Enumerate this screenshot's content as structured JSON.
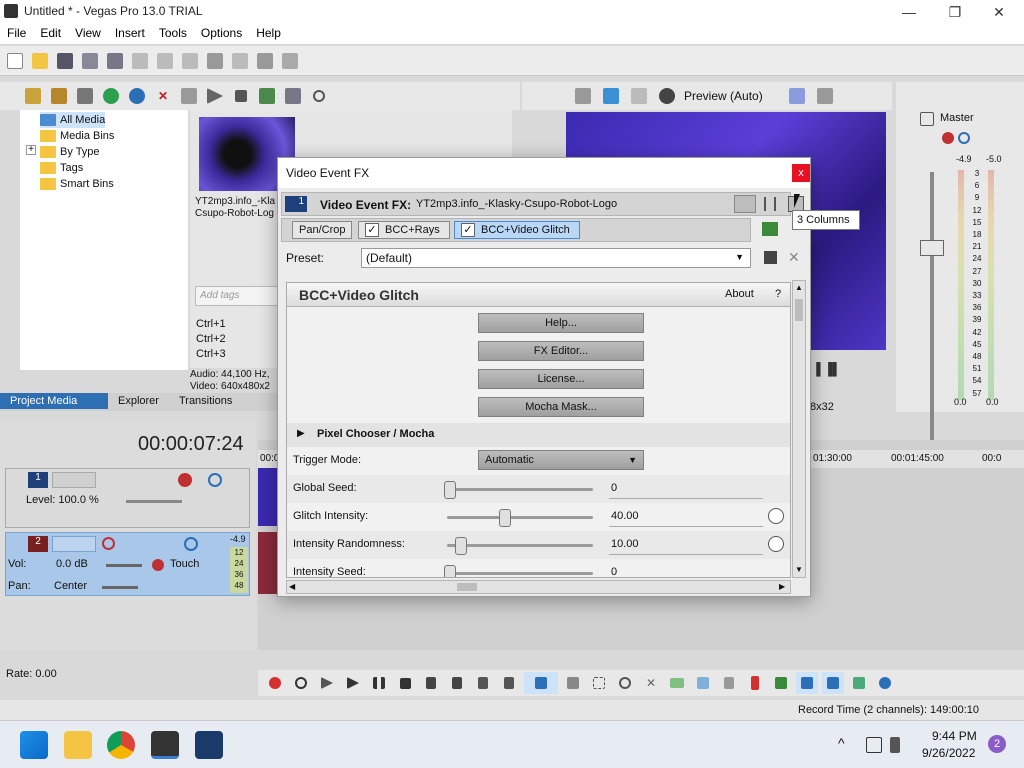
{
  "window": {
    "title": "Untitled * - Vegas Pro 13.0 TRIAL",
    "min": "—",
    "restore": "❐",
    "close": "✕"
  },
  "menu": [
    "File",
    "Edit",
    "View",
    "Insert",
    "Tools",
    "Options",
    "Help"
  ],
  "media": {
    "tree": [
      "All Media",
      "Media Bins",
      "By Type",
      "Tags",
      "Smart Bins"
    ],
    "expander": "+",
    "thumb_label_1": "YT2mp3.info_-Kla",
    "thumb_label_2": "Csupo-Robot-Log",
    "tags_placeholder": "Add tags",
    "shortcuts": [
      "Ctrl+1",
      "Ctrl+2",
      "Ctrl+3"
    ],
    "audio_info": "Audio: 44,100 Hz,",
    "video_info": "Video: 640x480x2",
    "tabs": [
      "Project Media",
      "Explorer",
      "Transitions"
    ]
  },
  "preview": {
    "mode": "Preview (Auto)",
    "size": "8x32"
  },
  "master": {
    "label": "Master",
    "peak_left": "-4.9",
    "peak_right": "-5.0",
    "scale": [
      "3",
      "6",
      "9",
      "12",
      "15",
      "18",
      "21",
      "24",
      "27",
      "30",
      "33",
      "36",
      "39",
      "42",
      "45",
      "48",
      "51",
      "54",
      "57"
    ],
    "val_left": "0.0",
    "val_right": "0.0"
  },
  "timeline": {
    "timecode": "00:00:07:24",
    "ruler": [
      "00:0",
      "01:30:00",
      "00:01:45:00",
      "00:0"
    ],
    "track1": {
      "num": "1",
      "level": "Level: 100.0 %"
    },
    "track2": {
      "num": "2",
      "vol": "Vol:",
      "vol_val": "0.0 dB",
      "pan": "Pan:",
      "pan_val": "Center",
      "mode": "Touch",
      "peak": "-4.9",
      "meter": [
        "12",
        "24",
        "36",
        "48"
      ]
    },
    "rate": "Rate: 0.00",
    "record_time": "Record Time (2 channels): 149:00:10"
  },
  "dialog": {
    "title": "Video Event FX",
    "close": "x",
    "track_num": "1",
    "fx_label": "Video Event FX:",
    "fx_name": "YT2mp3.info_-Klasky-Csupo-Robot-Logo",
    "chain": [
      "Pan/Crop",
      "BCC+Rays",
      "BCC+Video Glitch"
    ],
    "checkmark": "✓",
    "preset_label": "Preset:",
    "preset_value": "(Default)",
    "plugin_name": "BCC+Video Glitch",
    "about": "About",
    "help_q": "?",
    "buttons": [
      "Help...",
      "FX Editor...",
      "License...",
      "Mocha Mask..."
    ],
    "section": "Pixel Chooser / Mocha",
    "params": [
      {
        "label": "Trigger Mode:",
        "value": "Automatic"
      },
      {
        "label": "Global Seed:",
        "value": "0"
      },
      {
        "label": "Glitch Intensity:",
        "value": "40.00"
      },
      {
        "label": "Intensity Randomness:",
        "value": "10.00"
      },
      {
        "label": "Intensity Seed:",
        "value": "0"
      }
    ]
  },
  "tooltip": "3 Columns",
  "taskbar": {
    "time": "9:44 PM",
    "date": "9/26/2022",
    "notify": "2"
  },
  "colors": {
    "accent": "#2e6fb3",
    "close_red": "#e81123",
    "track_blue": "#a9c7e8"
  }
}
